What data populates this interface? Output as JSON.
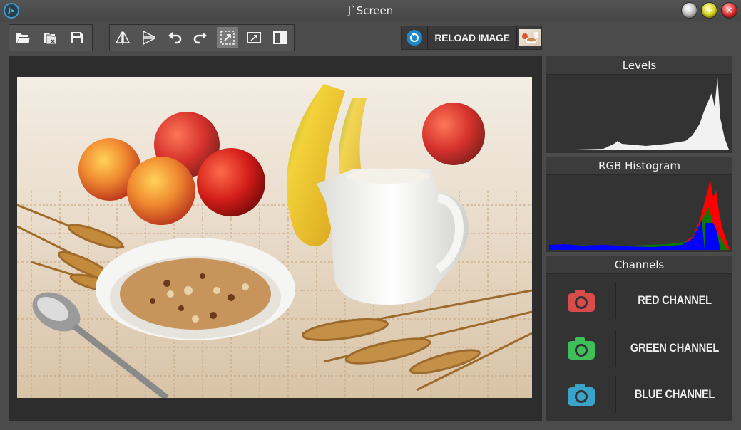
{
  "window": {
    "title": "J`Screen",
    "logo_text": "Js"
  },
  "toolbar": {
    "file_tools": [
      {
        "name": "open-folder-icon"
      },
      {
        "name": "open-recent-icon"
      },
      {
        "name": "save-icon"
      }
    ],
    "edit_tools": [
      {
        "name": "flip-horizontal-icon"
      },
      {
        "name": "flip-vertical-icon"
      },
      {
        "name": "undo-icon"
      },
      {
        "name": "redo-icon"
      },
      {
        "name": "resize-icon",
        "active": true
      },
      {
        "name": "fit-image-icon"
      },
      {
        "name": "compare-icon"
      }
    ],
    "reload_label": "RELOAD IMAGE"
  },
  "panels": {
    "levels_title": "Levels",
    "rgb_title": "RGB Histogram",
    "channels_title": "Channels"
  },
  "channels": [
    {
      "label": "RED CHANNEL",
      "color": "#d94c4c"
    },
    {
      "label": "GREEN CHANNEL",
      "color": "#3fbf5a"
    },
    {
      "label": "BLUE CHANNEL",
      "color": "#3aa3c9"
    }
  ],
  "colors": {
    "accent_blue": "#1e88c8",
    "histogram_red": "#ff0000",
    "histogram_green": "#008000",
    "histogram_blue": "#0000ff"
  }
}
